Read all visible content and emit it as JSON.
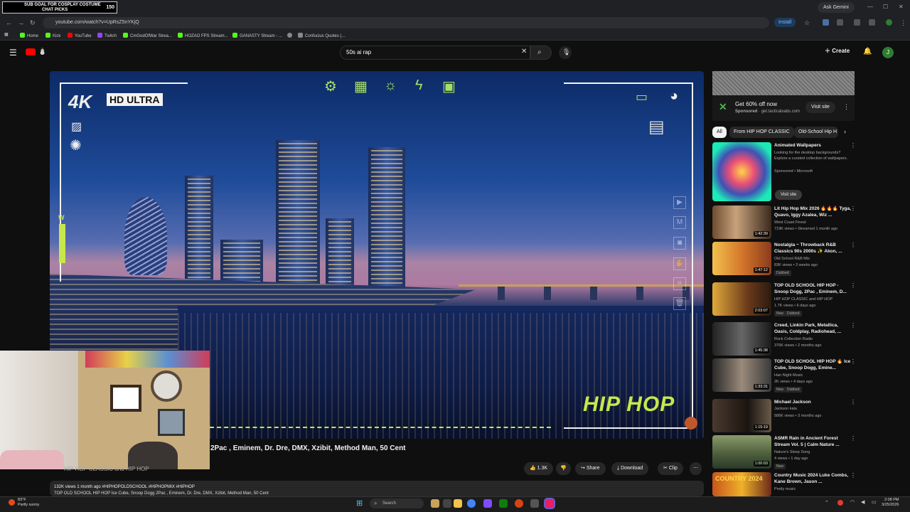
{
  "overlay": {
    "line1": "SUB GOAL FOR COSPLAY COSTUME",
    "line2": "CHAT PICKS",
    "count": "150"
  },
  "browser": {
    "ask_gemini": "Ask Gemini",
    "url": "youtube.com/watch?v=UpRsZ5nYKjQ",
    "install": "Install",
    "bookmarks": [
      "Home",
      "Kick",
      "YouTube",
      "Twitch",
      "CmGodOfWar Strea...",
      "HOZAO FPS Stream...",
      "GANASTY Stream - ...",
      "Confucius Quotes (..."
    ]
  },
  "youtube": {
    "search_value": "50s ai rap",
    "create_label": "Create",
    "avatar_letter": "J"
  },
  "player": {
    "badge_4k": "4K",
    "badge_hd": "HD ULTRA",
    "meter_label": "W",
    "brand_text": "HIP HOP"
  },
  "video": {
    "title": "2Pac , Eminem, Dr. Dre, DMX, Xzibit, Method Man, 50 Cent",
    "channel": "HIP HOP CLASSIC and HIP HOP",
    "likes": "1.3K",
    "share": "Share",
    "download": "Download",
    "clip": "Clip",
    "views_meta": "132K views  1 month ago  #HIPHOPOLDSCHOOL #HIPHOPMIX #HIPHOP",
    "description": "TOP OLD SCHOOL HIP HOP Ice Cube, Snoop Dogg 2Pac , Eminem, Dr. Dre, DMX, Xzibit, Method Man, 50 Cent"
  },
  "ad": {
    "title": "Get 60% off now",
    "sponsored": "Sponsored",
    "domain": "get.tacticalxabs.com",
    "visit": "Visit site"
  },
  "chips": [
    "All",
    "From HIP HOP CLASSIC",
    "Old-School Hip H"
  ],
  "recommendations": [
    {
      "title": "Animated Wallpapers",
      "desc": "Looking for the desktop backgrounds? Explore a curated collection of wallpapers.",
      "chan": "Sponsored • Microsoft",
      "visit": "Visit site"
    },
    {
      "title": "Lit Hip Hop Mix 2026 🔥🔥🔥 Tyga, Quavo, Iggy Azalea, Wiz ...",
      "chan": "West Coast Finest",
      "meta": "719K views • Streamed 1 month ago",
      "dur": "1:42:39"
    },
    {
      "title": "Nostalgia ~ Throwback R&B Classics 90s 2000s ✨ Akon, ...",
      "chan": "Old School R&B Mix",
      "meta": "83K views • 3 weeks ago",
      "dur": "1:47:12",
      "badge": "Dubbed"
    },
    {
      "title": "TOP OLD SCHOOL HIP HOP - Snoop Dogg, 2Pac , Eminem, D...",
      "chan": "HIP HOP CLASSIC and HIP HOP",
      "meta": "1.7K views • 6 days ago",
      "dur": "2:03:07",
      "badge": "New",
      "badge2": "Dubbed"
    },
    {
      "title": "Creed, Linkin Park, Metallica, Oasis, Coldplay, Radiohead, ...",
      "chan": "Rock Collection Radio",
      "meta": "376K views • 2 months ago",
      "dur": "1:45:38"
    },
    {
      "title": "TOP OLD SCHOOL HIP HOP 🔥 Ice Cube, Snoop Dogg, Emine...",
      "chan": "Han Night Music",
      "meta": "2K views • 4 days ago",
      "dur": "1:33:31",
      "badge": "New",
      "badge2": "Dubbed"
    },
    {
      "title": "Michael Jackson",
      "chan": "Jackson kala",
      "meta": "586K views • 3 months ago",
      "dur": "1:15:19"
    },
    {
      "title": "ASMR Rain in Ancient Forest Stream Vol. 5 | Calm Nature ...",
      "chan": "Nature's Sleep Song",
      "meta": "4 views • 1 day ago",
      "dur": "1:00:03",
      "badge": "New"
    },
    {
      "title": "Country Music 2024 Luke Combs, Kane Brown, Jason ...",
      "chan": "Pretty music",
      "meta": "",
      "dur": ""
    }
  ],
  "taskbar": {
    "weather_temp": "83°F",
    "weather_desc": "Partly sunny",
    "search": "Search",
    "time": "2:08 PM",
    "date": "3/25/2026"
  }
}
